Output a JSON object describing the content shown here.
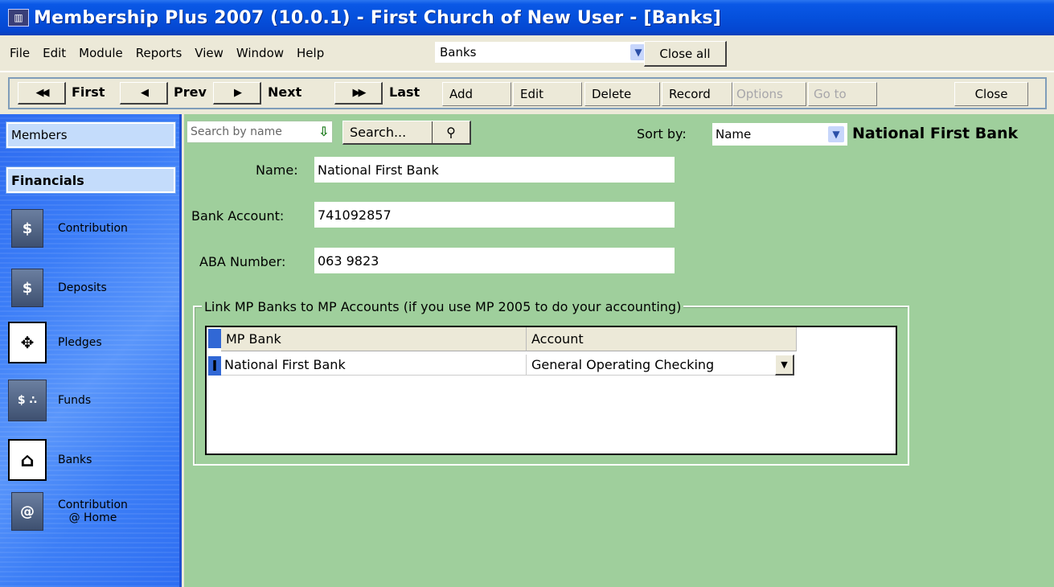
{
  "window": {
    "title": "Membership Plus 2007 (10.0.1) - First Church of New User - [Banks]"
  },
  "menu": {
    "items": [
      "File",
      "Edit",
      "Module",
      "Reports",
      "View",
      "Window",
      "Help"
    ],
    "module_select": "Banks",
    "close_all": "Close all"
  },
  "toolbar": {
    "first": "First",
    "prev": "Prev",
    "next": "Next",
    "last": "Last",
    "add": "Add",
    "edit": "Edit",
    "delete": "Delete",
    "record": "Record",
    "options": "Options",
    "goto": "Go to",
    "close": "Close"
  },
  "sidebar": {
    "members": "Members",
    "financials": "Financials",
    "items": [
      {
        "label": "Contribution",
        "icon": "contribution-icon"
      },
      {
        "label": "Deposits",
        "icon": "deposits-icon"
      },
      {
        "label": "Pledges",
        "icon": "pledges-icon"
      },
      {
        "label": "Funds",
        "icon": "funds-icon"
      },
      {
        "label": "Banks",
        "icon": "bank-icon"
      },
      {
        "label": "Contribution\n@ Home",
        "icon": "contribution-home-icon"
      }
    ]
  },
  "search": {
    "placeholder": "Search by name",
    "button": "Search...",
    "sort_label": "Sort by:",
    "sort_value": "Name",
    "record_title": "National First Bank"
  },
  "form": {
    "name_label": "Name:",
    "name_value": "National First Bank",
    "account_label": "Bank Account:",
    "account_value": "741092857",
    "aba_label": "ABA Number:",
    "aba_value": "063 9823"
  },
  "link_group": {
    "title": "Link MP Banks to MP Accounts (if you use MP 2005 to do your accounting)",
    "columns": [
      "MP Bank",
      "Account"
    ],
    "rows": [
      {
        "bank": "National First Bank",
        "account": "General Operating Checking"
      }
    ]
  },
  "colors": {
    "title_bar": "#0550dc",
    "content_bg": "#9fcf9c",
    "sidebar": "#3b7df7"
  }
}
